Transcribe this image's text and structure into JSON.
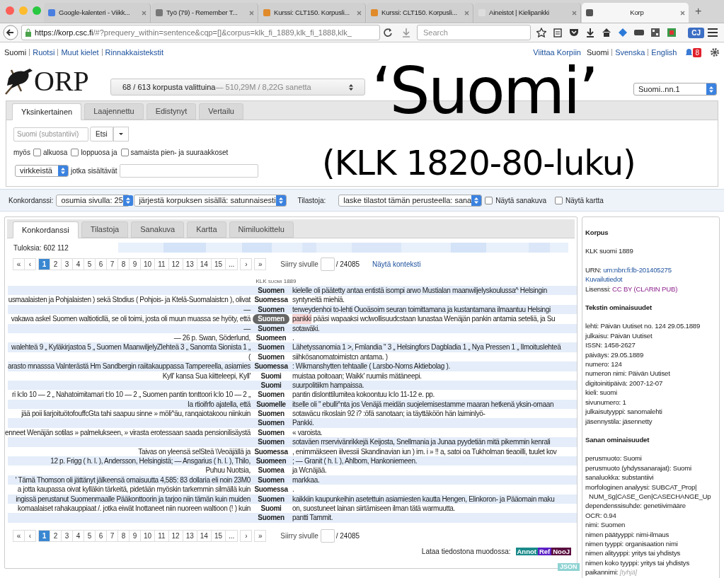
{
  "browser": {
    "tabs": [
      {
        "title": "Google-kalenteri - Viikk...",
        "selected": false
      },
      {
        "title": "Työ (79) - Remember T...",
        "selected": false
      },
      {
        "title": "Kurssi: CLT150. Korpusli...",
        "selected": false
      },
      {
        "title": "Kurssi: CLT150. Korpusli...",
        "selected": false
      },
      {
        "title": "Aineistot | Kielipankki",
        "selected": false
      },
      {
        "title": "Korp",
        "selected": true
      }
    ],
    "new_tab": "+",
    "url_host": "https://korp.csc.fi",
    "url_rest": "/#?prequery_within=sentence&cqp=[]&corpus=klk_fi_1889,klk_fi_1888,klk_",
    "search": {
      "placeholder": "Search"
    },
    "extension_badge": "CJ"
  },
  "top_links": {
    "left": [
      "Suomi",
      "Ruotsi",
      "Muut kielet",
      "Rinnakkaistekstit"
    ],
    "cite": "Viittaa Korpiin",
    "languages": [
      {
        "label": "Suomi",
        "selected": true
      },
      {
        "label": "Svenska",
        "selected": false
      },
      {
        "label": "English",
        "selected": false
      }
    ],
    "notifications": "8"
  },
  "logo": "ORP",
  "corpus_selector": {
    "selected": "68 / 613 korpusta valittuina",
    "size": " — 510,29M / 8,22G sanetta"
  },
  "mode_select": "Suomi..nn.1",
  "overlay": {
    "title": "‘Suomi’",
    "subtitle": "(KLK 1820-80-luku)"
  },
  "search_tabs": [
    {
      "label": "Yksinkertainen",
      "selected": true
    },
    {
      "label": "Laajennettu",
      "selected": false
    },
    {
      "label": "Edistynyt",
      "selected": false
    },
    {
      "label": "Vertailu",
      "selected": false
    }
  ],
  "search_form": {
    "placeholder": "Suomi (substantiivi)",
    "button": "Etsi",
    "also_label": "myös",
    "options": [
      {
        "label": "alkuosa",
        "checked": false
      },
      {
        "label": "loppuosa ja",
        "checked": false
      },
      {
        "label": "samaista pien- ja suuraakkoset",
        "checked": false
      }
    ],
    "within": "virkkeistä",
    "contains_label": "jotka sisältävät"
  },
  "toolbar": {
    "concordance_label": "Konkordanssi:",
    "hits_per_page": "osumia sivulla: 25",
    "sort": "järjestä korpuksen sisällä: satunnaisesti",
    "stats_label": "Tilastoja:",
    "stats_by": "laske tilastot tämän perusteella: sana",
    "toggles": [
      {
        "label": "Näytä sanakuva",
        "checked": false
      },
      {
        "label": "Näytä kartta",
        "checked": false
      }
    ]
  },
  "result_tabs": [
    {
      "label": "Konkordanssi",
      "selected": true
    },
    {
      "label": "Tilastoja",
      "selected": false
    },
    {
      "label": "Sanakuva",
      "selected": false
    },
    {
      "label": "Kartta",
      "selected": false
    },
    {
      "label": "Nimiluokittelu",
      "selected": false
    }
  ],
  "hits": "Tuloksia: 602 112",
  "pagination_top": {
    "pages": [
      {
        "label": "«",
        "selected": false
      },
      {
        "label": "‹",
        "selected": false
      },
      {
        "label": "1",
        "selected": true
      },
      {
        "label": "2",
        "selected": false
      },
      {
        "label": "3",
        "selected": false
      },
      {
        "label": "4",
        "selected": false
      },
      {
        "label": "5",
        "selected": false
      },
      {
        "label": "6",
        "selected": false
      },
      {
        "label": "7",
        "selected": false
      },
      {
        "label": "8",
        "selected": false
      },
      {
        "label": "9",
        "selected": false
      },
      {
        "label": "10",
        "selected": false
      },
      {
        "label": "11",
        "selected": false
      },
      {
        "label": "12",
        "selected": false
      },
      {
        "label": "13",
        "selected": false
      },
      {
        "label": "14",
        "selected": false
      },
      {
        "label": "15",
        "selected": false
      },
      {
        "label": "...",
        "selected": false
      },
      {
        "label": "›",
        "selected": false
      },
      {
        "label": "»",
        "selected": false
      }
    ],
    "goto_label": "Siirry sivulle",
    "total": "/ 24085",
    "context_link": "Näytä konteksti"
  },
  "corpus_heading": "KLK suomi 1889",
  "rows": [
    {
      "left": "",
      "match": "Suomen",
      "right": "kielelle oli päätetty antaa entistä isompi arwo Mustialan maanwiljelyskoulussa^ Helsingin",
      "selected": false
    },
    {
      "left": "usmaalaisten ja Pohjalaisten ) sekä Stodius ( Pohjois- ja Ktelä-Suomalaistcn ), olivat",
      "match": "Suomessa",
      "right": "syntyneitä miehiä.",
      "selected": false
    },
    {
      "left": "—",
      "match": "Suomen",
      "right": "terweydenhoi to-lehti Ouoäsoim seuran toimittamana ja kustantamana ilmaantuu Helsingi",
      "selected": false
    },
    {
      "left": "vakawa askel Suomen waltioticllä, se oli toimi, josta oli muun muassa se hyöty, että",
      "match": "Suomen",
      "linked": "pankki",
      "right": "pääsi wapaaksi wclwollisuudcstaan lunastaa Wenäjän pankin antamia seteliä, ja Su",
      "selected": true
    },
    {
      "left": "—",
      "match": "Suomen",
      "right": "sotawäki.",
      "selected": false
    },
    {
      "left": "— 26 p. Swan, Söderlund,",
      "match": "Suomeen",
      "right": ".",
      "selected": false
    },
    {
      "left": "walehteä 9 „ Kyläkirjastoa 5 „ Suomen MaanwiljelyZlehteä 3 „ Sanomta Sionista 1 „",
      "match": "Suomen",
      "right": "Lähetyssanomia 1 >, Fmlandia \" 3 „ Helsingfors Dagbladia 1 „ Nya Pressen 1 „ Ilmoituslehteä",
      "selected": false
    },
    {
      "left": "(",
      "match": "Suomen",
      "right": "siihkösanomatoimistcn antama. )",
      "selected": false
    },
    {
      "left": "arasto mnasssa Valnterästä Hm Sandbergin raiitakauppassa Tampereella, asiamies",
      "match": "Suomessa",
      "right": ": Wikmanshytten tehtaalle ( Larsbo-Norns Aktiebolag ).",
      "selected": false
    },
    {
      "left": "Kyll' kansa Sua kiitteleepi, Kyll'",
      "match": "Suomi",
      "right": "muistaa poitoaan; Waikk' ruumiis mätäneepi.",
      "selected": false
    },
    {
      "left": "",
      "match": "Suomi",
      "right": "suurpolitiikm hampaissa.",
      "selected": false
    },
    {
      "left": "ri k:lo 10 — 2 „ Nahatoimitamari t:lo 10 — 2 „ Suomen pantin tonttoori k:lo 10 — 2 „",
      "match": "Suomen",
      "right": "pantin dislonttilumitea kokoontuu k:lo 11-12 e. pp.",
      "selected": false
    },
    {
      "left": "Ia rtioifrfo ajatella, että",
      "match": "Suomelle",
      "right": "itselle oli \" ebulli^nta jos Venäjä meidän suojelemisestamme maaran hetkenä yksin-omaan",
      "selected": false
    },
    {
      "left": "jää poii liarjoituötofouffcGta tahi saapuu sinne » möli^äu, ranqaiotakoou niinkuin",
      "match": "Suomen",
      "right": "sotawäcu rikoslain 92 i? :öfä sanotaan; ia täyttäköön hän laiminlyö-",
      "selected": false
    },
    {
      "left": "",
      "match": "Suomen",
      "right": "Pankki.",
      "selected": false
    },
    {
      "left": "enneet Wenäjän sotilas » palmelukseen, » virasta erotessaan saada pensionilisäystä",
      "match": "Suomen",
      "right": "« varoista.",
      "selected": false
    },
    {
      "left": "",
      "match": "Suomen",
      "right": "sotaväen rrservivänrikkejä Keijosta, Snellmania ja Junaa pyydetiän mitä pikemmin kenrali",
      "selected": false
    },
    {
      "left": "Taivas on yleensä selSteä \\Veoäjällä ja",
      "match": "Suomessa",
      "right": ", enimmäkseen iilvessii Skandinavian iun ) im. i » !! a, satoi oa Tukholman tieaoilli, tuulet kov",
      "selected": false
    },
    {
      "left": "12 p. Frigg ( h. l. ), Andersson, Helsingistä; — Ansgarius ( h. l. ), Thilo,",
      "match": "Suomeen",
      "right": "; — Granit ( h. l. ), Ahlbom, Hankoniemeen.",
      "selected": false
    },
    {
      "left": "Puhuu Nuotsia,",
      "match": "Suomea",
      "right": "ja Wcnäjää.",
      "selected": false
    },
    {
      "left": "' Tämä Thomson oli jättänyt jälkeensä omaisuutta 4,585: 83 dollaria eli noin 23M0",
      "match": "Suomen",
      "right": "markkaa.",
      "selected": false
    },
    {
      "left": "a jotta kaupassa oivat kylläkin tärkeitä, pidetään myöskin tarkemmin silmällä kuin",
      "match": "Suomessa",
      "right": ".",
      "selected": false
    },
    {
      "left": "ingissä perustanut Suomenmaalle Pääkonttoorin ja tarjoo niin tämän kuin muiden",
      "match": "Suomen",
      "right": "kaikkiin kaupunkeihin asetettuin asiamiesten kautta Hengen, Elinkoron- ja Pääomain maku",
      "selected": false
    },
    {
      "left": "komaalaiset rahakauppiaat /. jotka eiwät lnottaneet niin nuoreen waltioon (! ) kuin",
      "match": "Suomi",
      "right": "on, suostuneet lainan siirtämiseen ilman tätä warmuutta.",
      "selected": false
    },
    {
      "left": "",
      "match": "Suomen",
      "right": "pantti Tammit.",
      "selected": false
    }
  ],
  "pagination_bottom": {
    "pages": [
      {
        "label": "«",
        "selected": false
      },
      {
        "label": "‹",
        "selected": false
      },
      {
        "label": "1",
        "selected": true
      },
      {
        "label": "2",
        "selected": false
      },
      {
        "label": "3",
        "selected": false
      },
      {
        "label": "4",
        "selected": false
      },
      {
        "label": "5",
        "selected": false
      },
      {
        "label": "6",
        "selected": false
      },
      {
        "label": "7",
        "selected": false
      },
      {
        "label": "8",
        "selected": false
      },
      {
        "label": "9",
        "selected": false
      },
      {
        "label": "10",
        "selected": false
      },
      {
        "label": "11",
        "selected": false
      },
      {
        "label": "12",
        "selected": false
      },
      {
        "label": "13",
        "selected": false
      },
      {
        "label": "14",
        "selected": false
      },
      {
        "label": "15",
        "selected": false
      },
      {
        "label": "...",
        "selected": false
      },
      {
        "label": "›",
        "selected": false
      },
      {
        "label": "»",
        "selected": false
      }
    ],
    "goto_label": "Siirry sivulle",
    "total": "/ 24085"
  },
  "download": {
    "label": "Lataa tiedostona muodossa:",
    "formats": [
      {
        "label": "Annot",
        "color": "#1a8a8a"
      },
      {
        "label": "Ref",
        "color": "#5b1fc4"
      },
      {
        "label": "NooJ",
        "color": "#5a1040"
      }
    ]
  },
  "json_badge": "JSON",
  "sidebar": {
    "sections": [
      {
        "title": "Korpus",
        "lines": [
          {
            "kind": "plain",
            "text": "KLK suomi 1889"
          }
        ],
        "after": [
          {
            "kind": "link",
            "label": "URN: ",
            "text": "urn:nbn:fi:lb-201405275"
          },
          {
            "kind": "link",
            "text": "Kuvailutiedot"
          },
          {
            "kind": "license",
            "label": "Lisenssi: ",
            "text": "CC BY (CLARIN PUB)"
          }
        ]
      },
      {
        "title": "Tekstin ominaisuudet",
        "lines": [
          {
            "kind": "plain",
            "text": "lehti: Päivän Uutiset no. 124 29.05.1889"
          },
          {
            "kind": "plain",
            "text": "julkaisu: Päivän Uutiset"
          },
          {
            "kind": "plain",
            "text": "ISSN: 1458-2627"
          },
          {
            "kind": "plain",
            "text": "päiväys: 29.05.1889"
          },
          {
            "kind": "plain",
            "text": "numero: 124"
          },
          {
            "kind": "plain",
            "text": "numeron nimi: Päivän Uutiset"
          },
          {
            "kind": "plain",
            "text": "digitoinitipäivä: 2007-12-07"
          },
          {
            "kind": "plain",
            "text": "kieli: suomi"
          },
          {
            "kind": "plain",
            "text": "sivunumero: 1"
          },
          {
            "kind": "plain",
            "text": "julkaisutyyppi: sanomalehti"
          },
          {
            "kind": "plain",
            "text": "jäsennystila: jäsennetty"
          }
        ]
      },
      {
        "title": "Sanan ominaisuudet",
        "lines": [
          {
            "kind": "plain",
            "text": "perusmuoto: Suomi"
          },
          {
            "kind": "plain",
            "text": "perusmuoto (yhdyssanarajat): Suomi"
          },
          {
            "kind": "plain",
            "text": "sanaluokka: substantiivi"
          },
          {
            "kind": "plain",
            "text": "morfologinen analyysi: SUBCAT_Prop|"
          },
          {
            "kind": "indent",
            "text": "NUM_Sg|CASE_Gen|CASECHANGE_Up"
          },
          {
            "kind": "plain",
            "text": "dependenssisuhde: genetiivimääre"
          },
          {
            "kind": "plain",
            "text": "OCR: 0.94"
          },
          {
            "kind": "plain",
            "text": "nimi: Suomen"
          },
          {
            "kind": "plain",
            "text": "nimen päätyyppi: nimi-ilmaus"
          },
          {
            "kind": "plain",
            "text": "nimen tyyppi: organisaation nimi"
          },
          {
            "kind": "plain",
            "text": "nimen alityyppi: yritys tai yhdistys"
          },
          {
            "kind": "plain",
            "text": "nimen koko tyyppi: yritys tai yhdistys"
          },
          {
            "kind": "empty",
            "label": "paikannimi: ",
            "text": "[tyhjä]"
          }
        ]
      }
    ]
  }
}
